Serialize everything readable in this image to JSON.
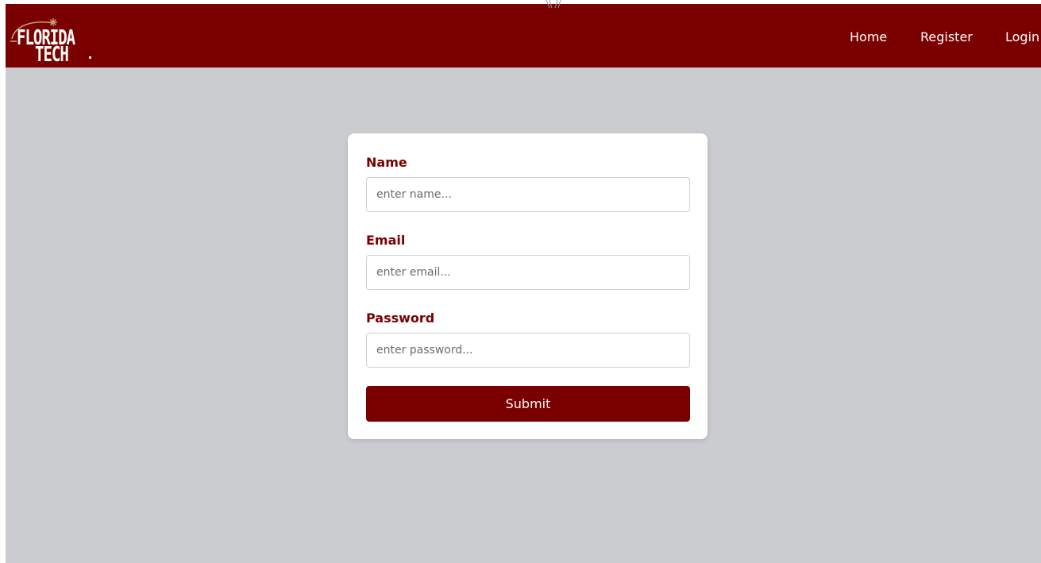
{
  "navbar": {
    "logo": {
      "line1": "FLORIDA",
      "line2": "TECH"
    },
    "links": [
      {
        "label": "Home"
      },
      {
        "label": "Register"
      },
      {
        "label": "Login"
      }
    ]
  },
  "form": {
    "fields": [
      {
        "label": "Name",
        "placeholder": "enter name...",
        "value": ""
      },
      {
        "label": "Email",
        "placeholder": "enter email...",
        "value": ""
      },
      {
        "label": "Password",
        "placeholder": "enter password...",
        "value": ""
      }
    ],
    "submit_label": "Submit"
  },
  "colors": {
    "brand": "#7a0000",
    "background": "#cbcccf",
    "card": "#ffffff"
  }
}
